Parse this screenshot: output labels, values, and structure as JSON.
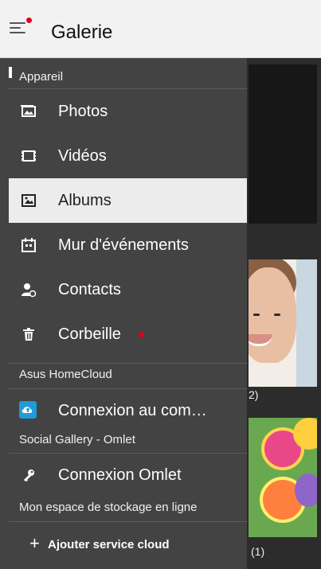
{
  "topbar": {
    "title": "Galerie"
  },
  "drawer": {
    "section_appareil": "Appareil",
    "items": [
      {
        "label": "Photos",
        "icon": "photos-icon"
      },
      {
        "label": "Vidéos",
        "icon": "videos-icon"
      },
      {
        "label": "Albums",
        "icon": "albums-icon"
      },
      {
        "label": "Mur d'événements",
        "icon": "events-icon"
      },
      {
        "label": "Contacts",
        "icon": "contacts-icon"
      },
      {
        "label": "Corbeille",
        "icon": "trash-icon"
      }
    ],
    "section_homecloud": "Asus HomeCloud",
    "homecloud_item": "Connexion au com…",
    "section_omlet": "Social Gallery - Omlet",
    "omlet_item": "Connexion Omlet",
    "section_storage": "Mon espace de stockage en ligne",
    "footer_label": "Ajouter service cloud",
    "footer_plus": "+"
  },
  "content": {
    "caption1": "2)",
    "caption2": "(1)"
  },
  "colors": {
    "accent_red": "#e0001b",
    "drawer_bg": "#434343",
    "active_bg": "#ececec",
    "cloud_blue": "#1f9bd7"
  }
}
